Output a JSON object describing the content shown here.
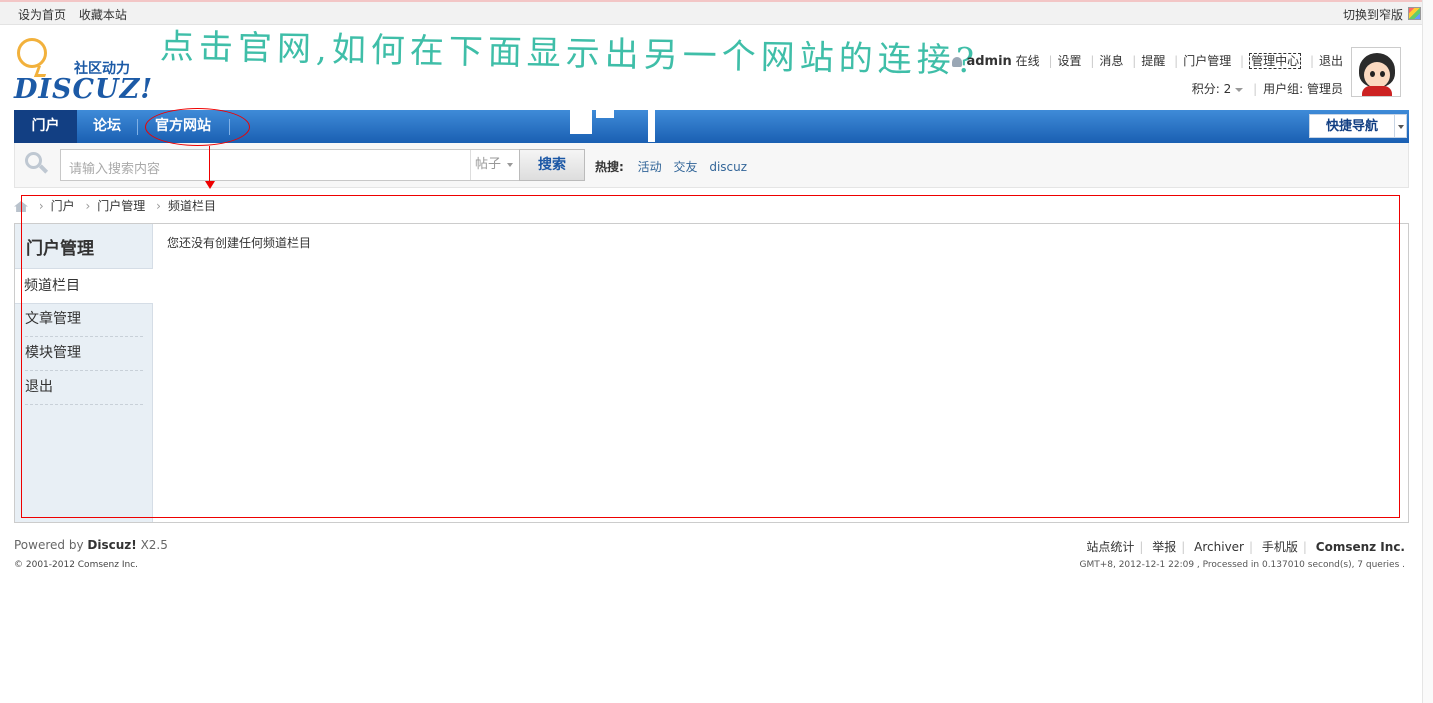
{
  "topbar": {
    "set_home": "设为首页",
    "bookmark": "收藏本站",
    "switch_width": "切换到窄版"
  },
  "logo": {
    "slogan": "社区动力",
    "wordmark": "DISCUZ!"
  },
  "annotation": {
    "question": "点击官网,如何在下面显示出另一个网站的连接?"
  },
  "user": {
    "name": "admin",
    "status": "在线",
    "links": [
      "设置",
      "消息",
      "提醒",
      "门户管理",
      "管理中心",
      "退出"
    ],
    "points_label": "积分: 2",
    "group_label": "用户组: 管理员"
  },
  "nav": {
    "items": [
      "门户",
      "论坛",
      "官方网站"
    ],
    "quick_nav": "快捷导航"
  },
  "search": {
    "placeholder": "请输入搜索内容",
    "scope": "帖子",
    "button": "搜索",
    "hot_label": "热搜:",
    "hot_terms": [
      "活动",
      "交友",
      "discuz"
    ]
  },
  "breadcrumb": [
    "门户",
    "门户管理",
    "频道栏目"
  ],
  "sidebar": {
    "title": "门户管理",
    "active": "频道栏目",
    "items": [
      "文章管理",
      "模块管理",
      "退出"
    ]
  },
  "main": {
    "message": "您还没有创建任何频道栏目"
  },
  "footer": {
    "powered_prefix": "Powered by",
    "powered_brand": "Discuz!",
    "version": "X2.5",
    "copyright": "© 2001-2012 Comsenz Inc.",
    "links": [
      "站点统计",
      "举报",
      "Archiver",
      "手机版"
    ],
    "company": "Comsenz Inc.",
    "debug": "GMT+8, 2012-12-1 22:09 , Processed in 0.137010 second(s), 7 queries ."
  }
}
